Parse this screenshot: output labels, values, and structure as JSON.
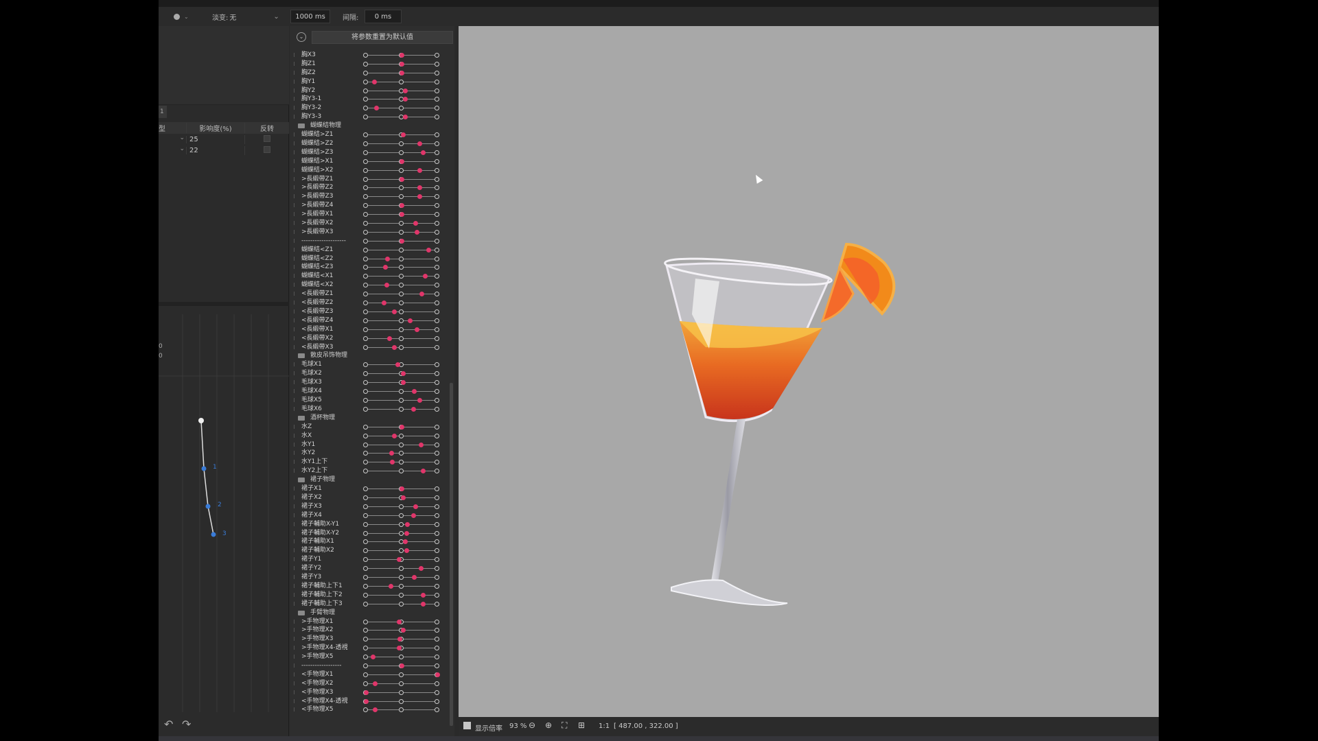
{
  "toolbar": {
    "fade_label": "淡变:",
    "fade_value": "无",
    "duration_value": "1000 ms",
    "interval_label": "间隔:",
    "interval_value": "0 ms"
  },
  "left_panel": {
    "tab_label": "1",
    "table": {
      "headers": [
        "型",
        "影响度(%)",
        "反转"
      ],
      "rows": [
        {
          "value": "25"
        },
        {
          "value": "22"
        }
      ]
    },
    "graph": {
      "axis_label_top": "0",
      "axis_label_bottom": "0",
      "points": [
        "1",
        "2",
        "3"
      ]
    }
  },
  "param_panel": {
    "reset_label": "将参数重置为默认值",
    "groups": [
      {
        "name": "",
        "items": [
          {
            "label": "胸X3",
            "v": 0.5
          },
          {
            "label": "胸Z1",
            "v": 0.5
          },
          {
            "label": "胸Z2",
            "v": 0.5
          },
          {
            "label": "胸Y1",
            "v": 0.12
          },
          {
            "label": "胸Y2",
            "v": 0.55
          },
          {
            "label": "胸Y3-1",
            "v": 0.55
          },
          {
            "label": "胸Y3-2",
            "v": 0.15
          },
          {
            "label": "胸Y3-3",
            "v": 0.55
          }
        ]
      },
      {
        "name": "蝴蝶结物理",
        "items": [
          {
            "label": "蝴蝶结>Z1",
            "v": 0.52
          },
          {
            "label": "蝴蝶结>Z2",
            "v": 0.75
          },
          {
            "label": "蝴蝶结>Z3",
            "v": 0.8
          },
          {
            "label": "蝴蝶结>X1",
            "v": 0.5
          },
          {
            "label": "蝴蝶结>X2",
            "v": 0.75
          },
          {
            "label": ">長緞帶Z1",
            "v": 0.5
          },
          {
            "label": ">長緞帶Z2",
            "v": 0.75
          },
          {
            "label": ">長緞帶Z3",
            "v": 0.75
          },
          {
            "label": ">長緞帶Z4",
            "v": 0.5
          },
          {
            "label": ">長緞帶X1",
            "v": 0.5
          },
          {
            "label": ">長緞帶X2",
            "v": 0.7
          },
          {
            "label": ">長緞帶X3",
            "v": 0.72
          },
          {
            "label": "--------------------",
            "v": 0.5
          },
          {
            "label": "蝴蝶结<Z1",
            "v": 0.88
          },
          {
            "label": "蝴蝶结<Z2",
            "v": 0.3
          },
          {
            "label": "蝴蝶结<Z3",
            "v": 0.27
          },
          {
            "label": "蝴蝶结<X1",
            "v": 0.83
          },
          {
            "label": "蝴蝶结<X2",
            "v": 0.29
          },
          {
            "label": "<長緞帶Z1",
            "v": 0.78
          },
          {
            "label": "<長緞帶Z2",
            "v": 0.25
          },
          {
            "label": "<長緞帶Z3",
            "v": 0.4
          },
          {
            "label": "<長緞帶Z4",
            "v": 0.62
          },
          {
            "label": "<長緞帶X1",
            "v": 0.72
          },
          {
            "label": "<長緞帶X2",
            "v": 0.33
          },
          {
            "label": "<長緞帶X3",
            "v": 0.4
          }
        ]
      },
      {
        "name": "散皮吊饰物理",
        "items": [
          {
            "label": "毛球X1",
            "v": 0.45
          },
          {
            "label": "毛球X2",
            "v": 0.52
          },
          {
            "label": "毛球X3",
            "v": 0.52
          },
          {
            "label": "毛球X4",
            "v": 0.68
          },
          {
            "label": "毛球X5",
            "v": 0.75
          },
          {
            "label": "毛球X6",
            "v": 0.67
          }
        ]
      },
      {
        "name": "酒杯物理",
        "items": [
          {
            "label": "水Z",
            "v": 0.5
          },
          {
            "label": "水X",
            "v": 0.4
          },
          {
            "label": "水Y1",
            "v": 0.77
          },
          {
            "label": "水Y2",
            "v": 0.36
          },
          {
            "label": "水Y1上下",
            "v": 0.37
          },
          {
            "label": "水Y2上下",
            "v": 0.8
          }
        ]
      },
      {
        "name": "裙子物理",
        "items": [
          {
            "label": "裙子X1",
            "v": 0.5
          },
          {
            "label": "裙子X2",
            "v": 0.52
          },
          {
            "label": "裙子X3",
            "v": 0.7
          },
          {
            "label": "裙子X4",
            "v": 0.67
          },
          {
            "label": "裙子輔助X-Y1",
            "v": 0.58
          },
          {
            "label": "裙子輔助X-Y2",
            "v": 0.57
          },
          {
            "label": "裙子輔助X1",
            "v": 0.55
          },
          {
            "label": "裙子輔助X2",
            "v": 0.57
          },
          {
            "label": "裙子Y1",
            "v": 0.47
          },
          {
            "label": "裙子Y2",
            "v": 0.77
          },
          {
            "label": "裙子Y3",
            "v": 0.68
          },
          {
            "label": "裙子輔助上下1",
            "v": 0.35
          },
          {
            "label": "裙子輔助上下2",
            "v": 0.8
          },
          {
            "label": "裙子輔助上下3",
            "v": 0.8
          }
        ]
      },
      {
        "name": "手臂物理",
        "items": [
          {
            "label": ">手物理X1",
            "v": 0.47
          },
          {
            "label": ">手物理X2",
            "v": 0.52
          },
          {
            "label": ">手物理X3",
            "v": 0.48
          },
          {
            "label": ">手物理X4-透視",
            "v": 0.47
          },
          {
            "label": ">手物理X5",
            "v": 0.1
          },
          {
            "label": "------------------",
            "v": 0.5
          },
          {
            "label": "<手物理X1",
            "v": 1.0
          },
          {
            "label": "<手物理X2",
            "v": 0.13
          },
          {
            "label": "<手物理X3",
            "v": 0.0
          },
          {
            "label": "<手物理X4-透視",
            "v": 0.0
          },
          {
            "label": "<手物理X5",
            "v": 0.13
          }
        ]
      }
    ]
  },
  "canvas_footer": {
    "show_magnify_label": "显示倍率",
    "zoom": "93 %",
    "ratio": "1:1",
    "coords": "[ 487.00 , 322.00 ]"
  }
}
